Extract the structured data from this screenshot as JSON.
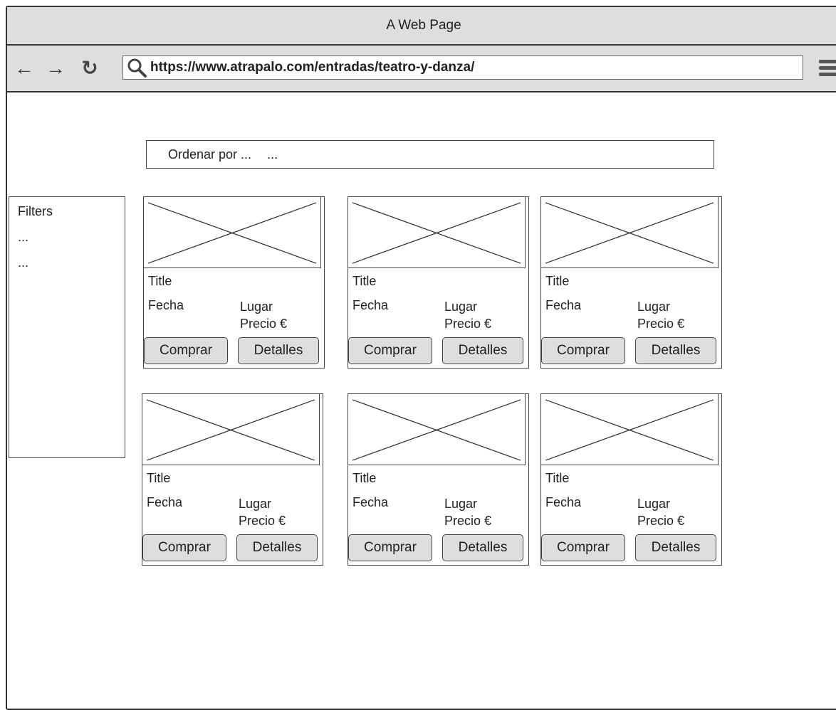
{
  "window": {
    "title": "A Web Page"
  },
  "browser": {
    "back_icon": "arrow-left-icon",
    "forward_icon": "arrow-right-icon",
    "reload_icon": "reload-icon",
    "url": "https://www.atrapalo.com/entradas/teatro-y-danza/",
    "menu_icon": "hamburger-menu-icon"
  },
  "sort": {
    "label": "Ordenar por ...",
    "value": "..."
  },
  "filters": {
    "title": "Filters",
    "items": [
      "...",
      "..."
    ]
  },
  "cards": [
    {
      "title": "Title",
      "fecha": "Fecha",
      "lugar": "Lugar",
      "precio": "Precio €",
      "buy_label": "Comprar",
      "details_label": "Detalles"
    },
    {
      "title": "Title",
      "fecha": "Fecha",
      "lugar": "Lugar",
      "precio": "Precio €",
      "buy_label": "Comprar",
      "details_label": "Detalles"
    },
    {
      "title": "Title",
      "fecha": "Fecha",
      "lugar": "Lugar",
      "precio": "Precio €",
      "buy_label": "Comprar",
      "details_label": "Detalles"
    },
    {
      "title": "Title",
      "fecha": "Fecha",
      "lugar": "Lugar",
      "precio": "Precio €",
      "buy_label": "Comprar",
      "details_label": "Detalles"
    },
    {
      "title": "Title",
      "fecha": "Fecha",
      "lugar": "Lugar",
      "precio": "Precio €",
      "buy_label": "Comprar",
      "details_label": "Detalles"
    },
    {
      "title": "Title",
      "fecha": "Fecha",
      "lugar": "Lugar",
      "precio": "Precio €",
      "buy_label": "Comprar",
      "details_label": "Detalles"
    }
  ]
}
